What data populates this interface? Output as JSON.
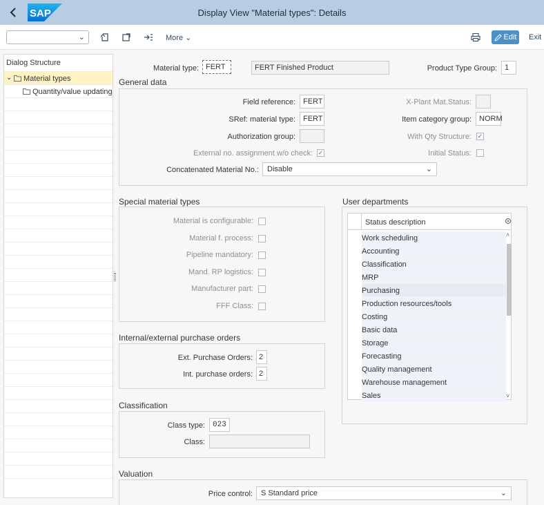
{
  "shell": {
    "title": "Display View \"Material types\": Details",
    "logo_text": "SAP"
  },
  "toolbar": {
    "more_label": "More",
    "edit_label": "Edit",
    "exit_label": "Exit"
  },
  "dialog_structure": {
    "title": "Dialog Structure",
    "items": [
      {
        "label": "Material types",
        "selected": true
      },
      {
        "label": "Quantity/value updating",
        "selected": false
      }
    ]
  },
  "header": {
    "material_type_label": "Material type:",
    "material_type_value": "FERT",
    "material_type_desc": "FERT Finished Product",
    "product_type_group_label": "Product Type Group:",
    "product_type_group_value": "1"
  },
  "general_data": {
    "title": "General data",
    "field_reference_label": "Field reference:",
    "field_reference_value": "FERT",
    "sref_label": "SRef: material type:",
    "sref_value": "FERT",
    "auth_group_label": "Authorization group:",
    "auth_group_value": "",
    "ext_no_label": "External no. assignment w/o check:",
    "ext_no_checked": true,
    "concat_label": "Concatenated Material No.:",
    "concat_value": "Disable",
    "xplant_label": "X-Plant Mat.Status:",
    "xplant_value": "",
    "item_cat_label": "Item category group:",
    "item_cat_value": "NORM",
    "with_qty_label": "With Qty Structure:",
    "with_qty_checked": true,
    "initial_status_label": "Initial Status:",
    "initial_status_checked": false
  },
  "special_material_types": {
    "title": "Special material types",
    "items": [
      {
        "label": "Material is configurable:",
        "checked": false
      },
      {
        "label": "Material f. process:",
        "checked": false
      },
      {
        "label": "Pipeline mandatory:",
        "checked": false
      },
      {
        "label": "Mand. RP logistics:",
        "checked": false
      },
      {
        "label": "Manufacturer part:",
        "checked": false
      },
      {
        "label": "FFF Class:",
        "checked": false
      }
    ]
  },
  "user_departments": {
    "title": "User departments",
    "column_header": "Status description",
    "rows": [
      "Work scheduling",
      "Accounting",
      "Classification",
      "MRP",
      "Purchasing",
      "Production resources/tools",
      "Costing",
      "Basic data",
      "Storage",
      "Forecasting",
      "Quality management",
      "Warehouse management",
      "Sales"
    ]
  },
  "purchase_orders": {
    "title": "Internal/external purchase orders",
    "ext_label": "Ext. Purchase Orders:",
    "ext_value": "2",
    "int_label": "Int. purchase orders:",
    "int_value": "2"
  },
  "classification": {
    "title": "Classification",
    "class_type_label": "Class type:",
    "class_type_value": "023",
    "class_label": "Class:",
    "class_value": ""
  },
  "valuation": {
    "title": "Valuation",
    "price_control_label": "Price control:",
    "price_control_value": "S Standard price"
  }
}
